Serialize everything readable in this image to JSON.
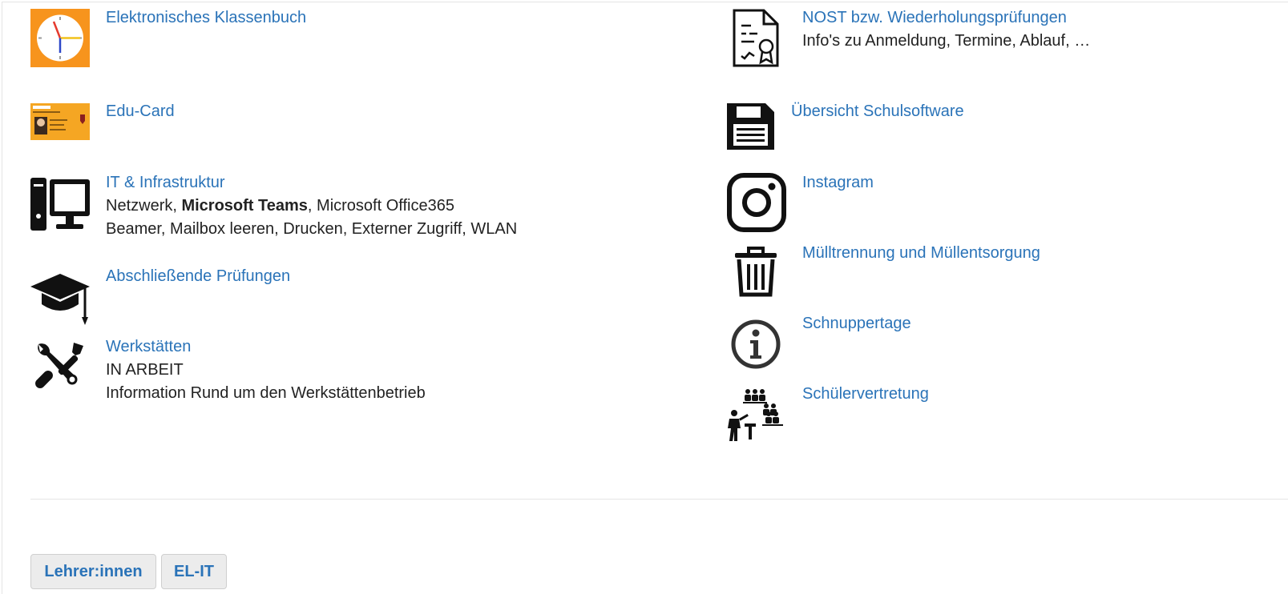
{
  "left": [
    {
      "title": "Elektronisches Klassenbuch",
      "icon": "clock-icon"
    },
    {
      "title": "Edu-Card",
      "icon": "id-card-icon"
    },
    {
      "title": "IT & Infrastruktur",
      "icon": "computer-icon",
      "line1_pre": "Netzwerk, ",
      "line1_bold": "Microsoft Teams",
      "line1_post": ", Microsoft Office365",
      "line2": "Beamer, Mailbox leeren, Drucken, Externer Zugriff, WLAN"
    },
    {
      "title": "Abschließende Prüfungen",
      "icon": "graduation-cap-icon"
    },
    {
      "title": "Werkstätten",
      "icon": "tools-icon",
      "line1": "IN ARBEIT",
      "line2": "Information Rund um den Werkstättenbetrieb"
    }
  ],
  "right": [
    {
      "title": "NOST bzw. Wiederholungsprüfungen",
      "icon": "certificate-document-icon",
      "line1": "Info's zu Anmeldung, Termine, Ablauf, …"
    },
    {
      "title": "Übersicht Schulsoftware",
      "icon": "floppy-disk-icon"
    },
    {
      "title": "Instagram",
      "icon": "instagram-icon"
    },
    {
      "title": "Mülltrennung und Müllentsorgung",
      "icon": "trash-can-icon"
    },
    {
      "title": "Schnuppertage",
      "icon": "info-circle-icon"
    },
    {
      "title": "Schülervertretung",
      "icon": "classroom-icon"
    }
  ],
  "buttons": {
    "teachers": "Lehrer:innen",
    "elit": "EL-IT"
  },
  "colors": {
    "link": "#2a73b8",
    "clock_bg": "#f7941d"
  }
}
